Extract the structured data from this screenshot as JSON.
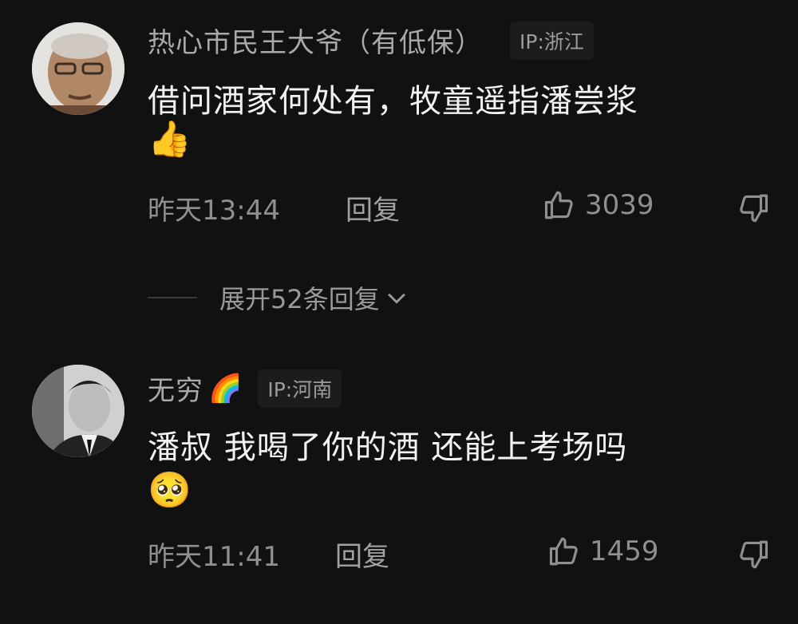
{
  "comments": [
    {
      "username": "热心市民王大爷（有低保）",
      "ip": "IP:浙江",
      "text": "借问酒家何处有，牧童遥指潘尝浆",
      "emoji": "👍",
      "time": "昨天13:44",
      "reply_label": "回复",
      "likes": "3039"
    },
    {
      "username": "无穷",
      "username_emoji": "🌈",
      "ip": "IP:河南",
      "text": "潘叔 我喝了你的酒  还能上考场吗",
      "emoji": "🥺",
      "time": "昨天11:41",
      "reply_label": "回复",
      "likes": "1459"
    }
  ],
  "expand": {
    "label": "展开52条回复"
  },
  "icons": [
    "thumbs-up-icon",
    "thumbs-down-icon",
    "chevron-down-icon"
  ],
  "colors": {
    "background": "#111112",
    "username": "#a9a9ab",
    "text": "#f2f2f2",
    "meta": "#8f8f91"
  }
}
